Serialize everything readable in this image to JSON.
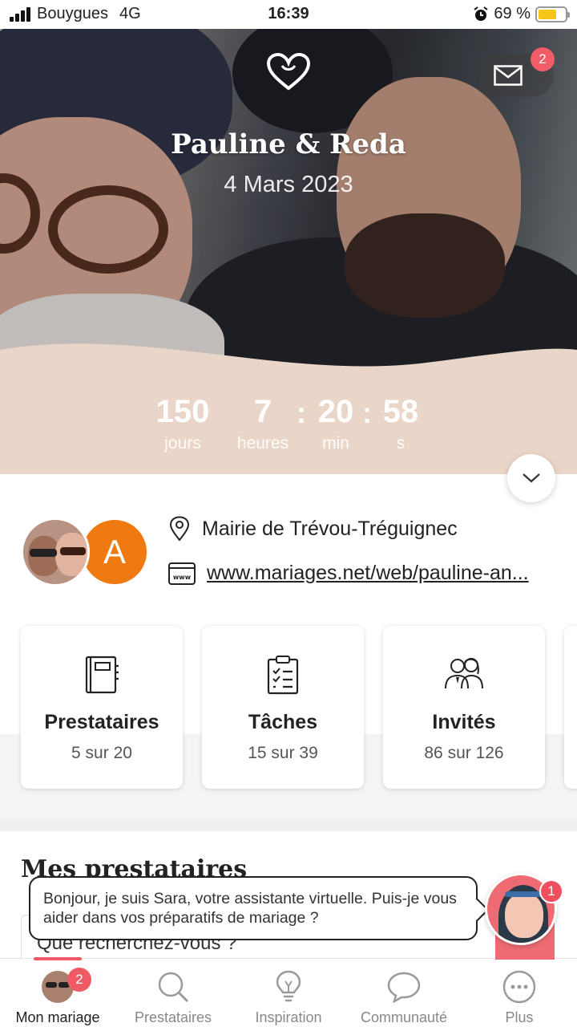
{
  "status_bar": {
    "carrier": "Bouygues",
    "network": "4G",
    "time": "16:39",
    "battery": "69 %",
    "battery_level": 0.69
  },
  "header": {
    "couple": "Pauline & Reda",
    "date": "4 Mars 2023",
    "mail_badge": "2"
  },
  "countdown": {
    "days": "150",
    "days_label": "jours",
    "hours": "7",
    "hours_label": "heures",
    "minutes": "20",
    "minutes_label": "min",
    "seconds": "58",
    "seconds_label": "s",
    "separator": ":"
  },
  "profile": {
    "avatar_letter": "A",
    "location": "Mairie de Trévou-Tréguignec",
    "website": "www.mariages.net/web/pauline-an..."
  },
  "cards": [
    {
      "title": "Prestataires",
      "subtitle": "5 sur 20"
    },
    {
      "title": "Tâches",
      "subtitle": "15 sur 39"
    },
    {
      "title": "Invités",
      "subtitle": "86 sur 126"
    }
  ],
  "section": {
    "title": "Mes prestataires",
    "search_placeholder": "Que recherchez-vous ?"
  },
  "assistant": {
    "message": "Bonjour, je suis Sara, votre assistante virtuelle. Puis-je vous aider dans vos préparatifs de mariage ?",
    "badge": "1"
  },
  "tabbar": {
    "badge": "2",
    "items": [
      {
        "label": "Mon mariage",
        "icon": "couple-avatar-icon"
      },
      {
        "label": "Prestataires",
        "icon": "search-icon"
      },
      {
        "label": "Inspiration",
        "icon": "lightbulb-icon"
      },
      {
        "label": "Communauté",
        "icon": "chat-bubble-icon"
      },
      {
        "label": "Plus",
        "icon": "more-dots-icon"
      }
    ]
  },
  "colors": {
    "accent": "#ef5a64",
    "beige": "#ead6c9",
    "avatar_orange": "#f07a12"
  }
}
